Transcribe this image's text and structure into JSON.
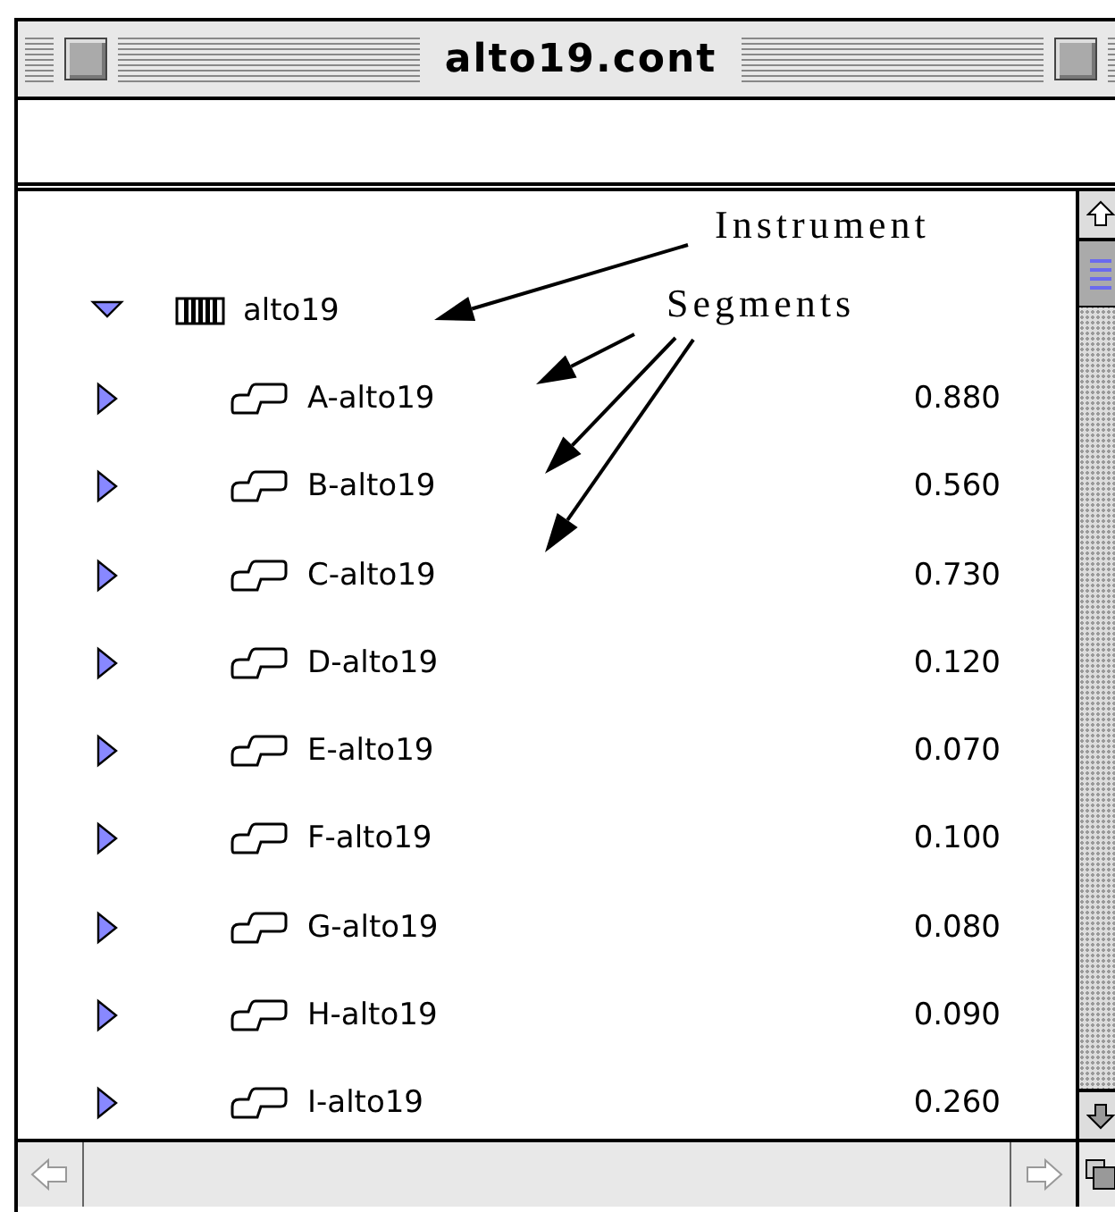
{
  "window": {
    "title": "alto19.cont"
  },
  "tree": {
    "name": "alto19",
    "kind": "instrument",
    "expanded": true,
    "children": [
      {
        "name": "A-alto19",
        "kind": "segment",
        "value": "0.880",
        "expanded": false
      },
      {
        "name": "B-alto19",
        "kind": "segment",
        "value": "0.560",
        "expanded": false
      },
      {
        "name": "C-alto19",
        "kind": "segment",
        "value": "0.730",
        "expanded": false
      },
      {
        "name": "D-alto19",
        "kind": "segment",
        "value": "0.120",
        "expanded": false
      },
      {
        "name": "E-alto19",
        "kind": "segment",
        "value": "0.070",
        "expanded": false
      },
      {
        "name": "F-alto19",
        "kind": "segment",
        "value": "0.100",
        "expanded": false
      },
      {
        "name": "G-alto19",
        "kind": "segment",
        "value": "0.080",
        "expanded": false
      },
      {
        "name": "H-alto19",
        "kind": "segment",
        "value": "0.090",
        "expanded": false
      },
      {
        "name": "I-alto19",
        "kind": "segment",
        "value": "0.260",
        "expanded": false
      }
    ]
  },
  "annotations": [
    {
      "text": "Instrument"
    },
    {
      "text": "Segments"
    }
  ]
}
